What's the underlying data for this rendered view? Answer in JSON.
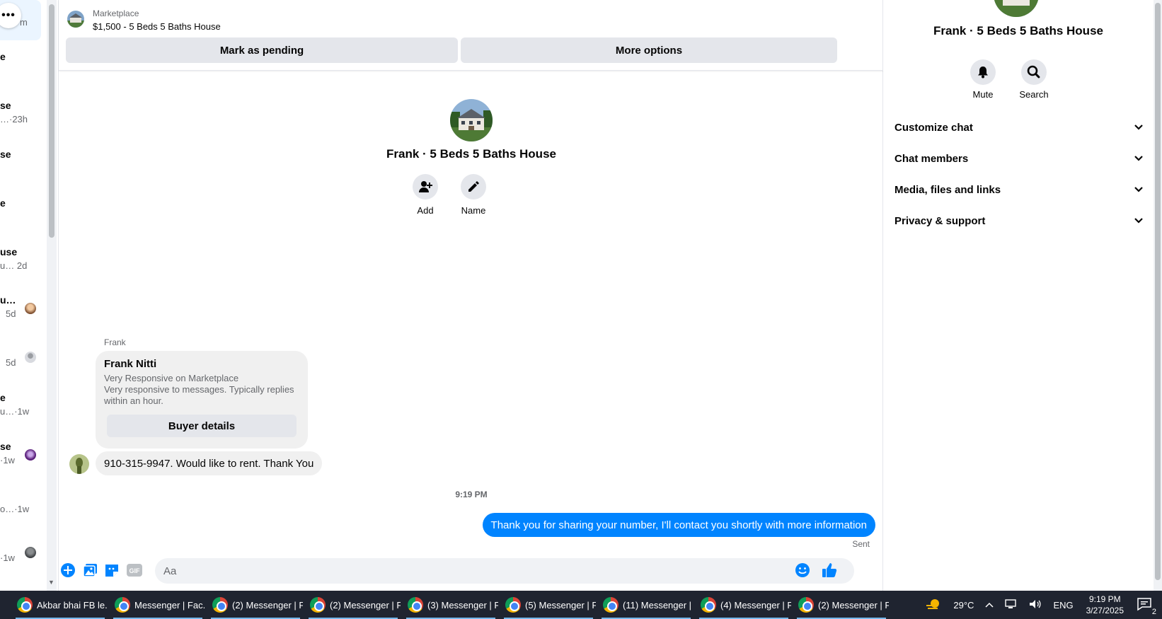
{
  "conversation_list": {
    "more_label": "•••",
    "rows": [
      {
        "t1": "",
        "t2": "m"
      },
      {
        "t1": "e",
        "t2": ""
      },
      {
        "t1": "se",
        "t2": "…·23h"
      },
      {
        "t1": "se",
        "t2": ""
      },
      {
        "t1": "e",
        "t2": ""
      },
      {
        "t1": "use",
        "t2": "u… 2d"
      },
      {
        "t1": "u…",
        "t2": "5d"
      },
      {
        "t1": "",
        "t2": "5d"
      },
      {
        "t1": "e",
        "t2": "u…·1w"
      },
      {
        "t1": "se",
        "t2": "·1w"
      },
      {
        "t1": "",
        "t2": "o…·1w"
      },
      {
        "t1": "",
        "t2": "·1w"
      }
    ]
  },
  "marketplace": {
    "label": "Marketplace",
    "title": "$1,500 - 5 Beds 5 Baths House",
    "mark_pending": "Mark as pending",
    "more_options": "More options"
  },
  "thread": {
    "title": "Frank · 5 Beds 5 Baths House",
    "add_label": "Add",
    "name_label": "Name"
  },
  "messages": {
    "sender_name": "Frank",
    "card": {
      "name": "Frank Nitti",
      "line1": "Very Responsive on Marketplace",
      "line2": "Very responsive to messages. Typically replies within an hour.",
      "button": "Buyer details"
    },
    "incoming": "910-315-9947. Would like to rent. Thank You",
    "timestamp": "9:19 PM",
    "outgoing": "Thank you for sharing your number, I'll contact you shortly with more information",
    "status": "Sent"
  },
  "composer": {
    "placeholder": "Aa",
    "gif_label": "GIF"
  },
  "info_panel": {
    "title": "Frank · 5 Beds 5 Baths House",
    "mute_label": "Mute",
    "search_label": "Search",
    "sections": [
      "Customize chat",
      "Chat members",
      "Media, files and links",
      "Privacy & support"
    ]
  },
  "taskbar": {
    "tasks": [
      "Akbar bhai FB le...",
      "Messenger | Fac...",
      "(2) Messenger | F...",
      "(2) Messenger | F...",
      "(3) Messenger | F...",
      "(5) Messenger | F...",
      "(11) Messenger | ...",
      "(4) Messenger | F...",
      "(2) Messenger | F..."
    ],
    "weather": "29°C",
    "language": "ENG",
    "time": "9:19 PM",
    "date": "3/27/2025",
    "notifications": "2"
  },
  "colors": {
    "accent": "#0084ff",
    "bubble_in": "#f0f0f0",
    "button_bg": "#e4e6eb",
    "muted_text": "#65676b"
  }
}
